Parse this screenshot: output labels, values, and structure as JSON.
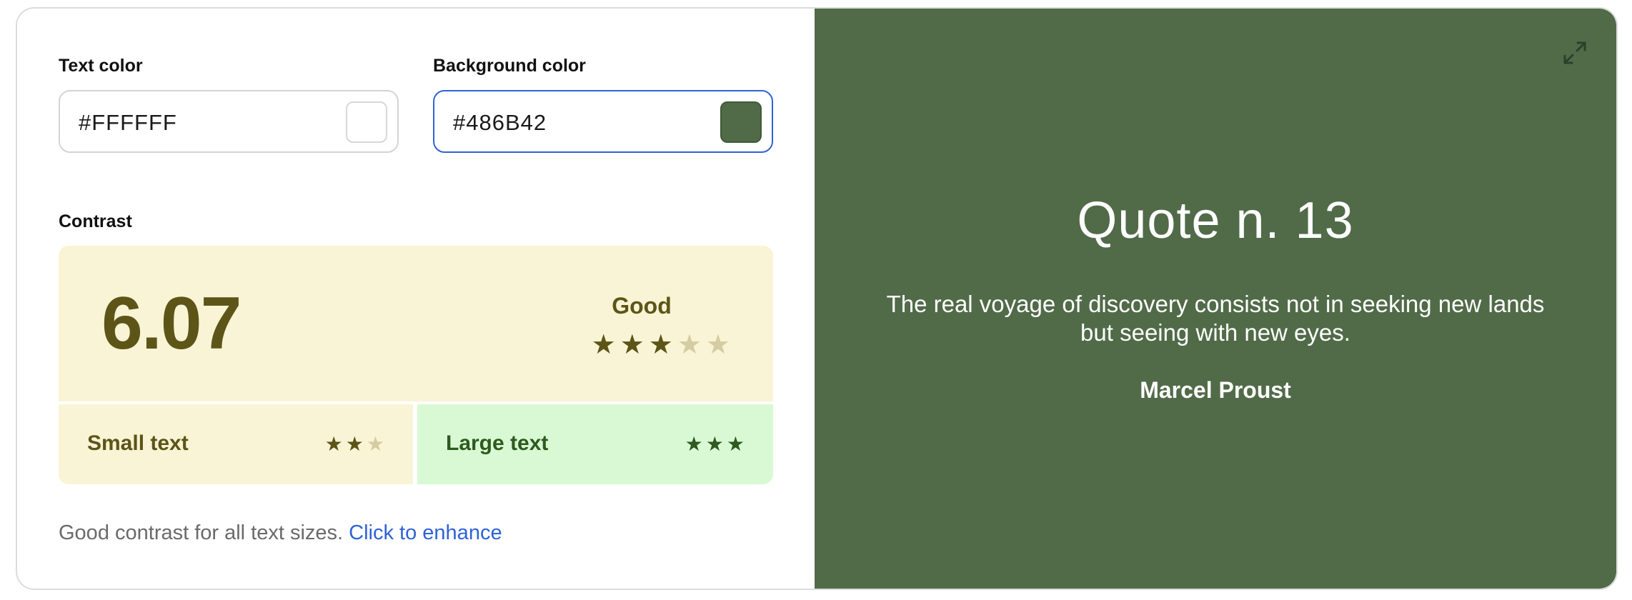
{
  "editor": {
    "text_color_label": "Text color",
    "text_color_value": "#FFFFFF",
    "text_color_swatch": "#FFFFFF",
    "background_color_label": "Background color",
    "background_color_value": "#486B42",
    "background_color_swatch": "#516B48"
  },
  "contrast": {
    "label": "Contrast",
    "ratio": "6.07",
    "rating": "Good",
    "rating_stars": 3,
    "rating_stars_max": 5,
    "small_text_label": "Small text",
    "small_text_stars": 2,
    "small_text_stars_max": 3,
    "large_text_label": "Large text",
    "large_text_stars": 3,
    "large_text_stars_max": 3
  },
  "footer": {
    "message": "Good contrast for all text sizes. ",
    "link": "Click to enhance"
  },
  "preview": {
    "expand_icon": "expand-icon",
    "title": "Quote n. 13",
    "quote": "The real voyage of discovery consists not in seeking new lands but seeing with new eyes.",
    "author": "Marcel Proust"
  },
  "colors": {
    "accent": "#2F62D6",
    "preview_bg": "#516B48",
    "good_text": "#5D5418",
    "good_bg": "#F9F4D5",
    "large_bg": "#D9F9D4",
    "large_text": "#2E5A1F"
  }
}
